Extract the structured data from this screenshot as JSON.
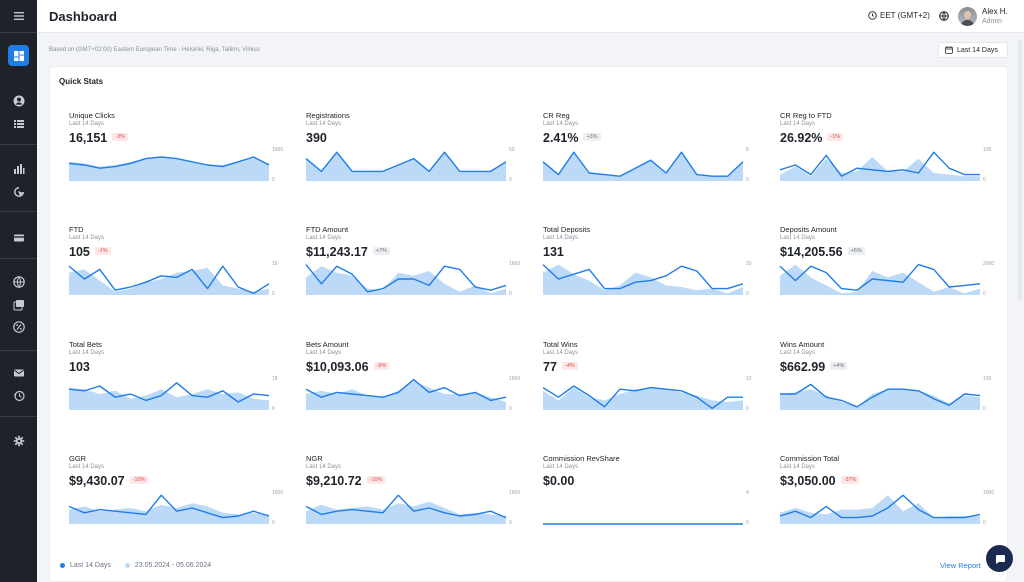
{
  "header": {
    "title": "Dashboard",
    "timezone": "EET (GMT+2)",
    "user_name": "Alex H.",
    "user_role": "Admin"
  },
  "subbar": {
    "based_on": "Based on (GMT+02:00) Eastern European Time - Helsinki, Riga, Tallinn, Vilnius",
    "range_button": "Last 14 Days"
  },
  "sidebar": {
    "icons": [
      "menu-icon",
      "dashboard-icon",
      "user-icon",
      "list-icon",
      "bar-chart-icon",
      "pointer-icon",
      "card-icon",
      "globe-icon",
      "images-icon",
      "percent-icon",
      "mail-icon",
      "history-icon",
      "settings-icon"
    ]
  },
  "colors": {
    "accent": "#1f7de8",
    "line": "#1f7de8",
    "area": "#bcdaf8",
    "sidebar": "#1f2329"
  },
  "quick_stats": {
    "title": "Quick Stats",
    "legend": {
      "current": "Last 14 Days",
      "previous": "23.05.2024 - 05.06.2024"
    },
    "view_report": "View Report",
    "stats": [
      {
        "name": "Unique Clicks",
        "period": "Last 14 Days",
        "value": "16,151",
        "change": "-3%",
        "trend": "neg",
        "ymax": "1600",
        "ymin": "0",
        "current": [
          0.45,
          0.5,
          0.6,
          0.55,
          0.45,
          0.3,
          0.25,
          0.3,
          0.4,
          0.5,
          0.55,
          0.4,
          0.25,
          0.5
        ],
        "previous": [
          0.4,
          0.45,
          0.55,
          0.5,
          0.4,
          0.3,
          0.28,
          0.32,
          0.38,
          0.48,
          0.5,
          0.38,
          0.28,
          0.45
        ]
      },
      {
        "name": "Registrations",
        "period": "Last 14 Days",
        "value": "390",
        "change": "",
        "trend": "none",
        "ymax": "60",
        "ymin": "0",
        "current": [
          0.3,
          0.7,
          0.1,
          0.7,
          0.7,
          0.7,
          0.5,
          0.3,
          0.7,
          0.1,
          0.7,
          0.7,
          0.7,
          0.4
        ],
        "previous": [
          0.3,
          0.7,
          0.1,
          0.7,
          0.7,
          0.7,
          0.5,
          0.3,
          0.7,
          0.1,
          0.7,
          0.7,
          0.7,
          0.4
        ]
      },
      {
        "name": "CR Reg",
        "period": "Last 14 Days",
        "value": "2.41%",
        "change": "+3%",
        "trend": "pos",
        "ymax": "8",
        "ymin": "0",
        "current": [
          0.4,
          0.8,
          0.1,
          0.75,
          0.8,
          0.85,
          0.6,
          0.35,
          0.75,
          0.1,
          0.8,
          0.85,
          0.85,
          0.4
        ],
        "previous": [
          0.4,
          0.8,
          0.1,
          0.75,
          0.8,
          0.85,
          0.6,
          0.35,
          0.75,
          0.1,
          0.8,
          0.85,
          0.85,
          0.4
        ]
      },
      {
        "name": "CR Reg to FTD",
        "period": "Last 14 Days",
        "value": "26.92%",
        "change": "-1%",
        "trend": "neg",
        "ymax": "100",
        "ymin": "0",
        "current": [
          0.65,
          0.5,
          0.8,
          0.2,
          0.85,
          0.6,
          0.65,
          0.7,
          0.65,
          0.75,
          0.1,
          0.6,
          0.8,
          0.8
        ],
        "previous": [
          0.8,
          0.55,
          0.85,
          0.3,
          0.75,
          0.7,
          0.25,
          0.7,
          0.7,
          0.3,
          0.75,
          0.8,
          0.85,
          0.85
        ]
      },
      {
        "name": "FTD",
        "period": "Last 14 Days",
        "value": "105",
        "change": "-1%",
        "trend": "neg",
        "ymax": "18",
        "ymin": "0",
        "current": [
          0.1,
          0.5,
          0.2,
          0.85,
          0.75,
          0.6,
          0.4,
          0.45,
          0.2,
          0.8,
          0.1,
          0.75,
          0.95,
          0.65
        ],
        "previous": [
          0.3,
          0.2,
          0.55,
          0.9,
          0.8,
          0.6,
          0.5,
          0.3,
          0.25,
          0.15,
          0.7,
          0.8,
          0.9,
          0.8
        ]
      },
      {
        "name": "FTD Amount",
        "period": "Last 14 Days",
        "value": "$11,243.17",
        "change": "+7%",
        "trend": "pos",
        "ymax": "1600",
        "ymin": "0",
        "current": [
          0.05,
          0.65,
          0.1,
          0.35,
          0.9,
          0.8,
          0.5,
          0.5,
          0.7,
          0.1,
          0.2,
          0.75,
          0.85,
          0.7
        ],
        "previous": [
          0.45,
          0.1,
          0.3,
          0.4,
          0.8,
          0.85,
          0.3,
          0.4,
          0.25,
          0.65,
          0.9,
          0.7,
          0.95,
          0.8
        ]
      },
      {
        "name": "Total Deposits",
        "period": "Last 14 Days",
        "value": "131",
        "change": "",
        "trend": "none",
        "ymax": "20",
        "ymin": "0",
        "current": [
          0.05,
          0.5,
          0.35,
          0.2,
          0.8,
          0.8,
          0.6,
          0.55,
          0.4,
          0.1,
          0.25,
          0.8,
          0.8,
          0.65
        ],
        "previous": [
          0.3,
          0.05,
          0.35,
          0.55,
          0.85,
          0.7,
          0.3,
          0.45,
          0.7,
          0.75,
          0.85,
          0.8,
          0.95,
          0.75
        ]
      },
      {
        "name": "Deposits Amount",
        "period": "Last 14 Days",
        "value": "$14,205.56",
        "change": "+5%",
        "trend": "pos",
        "ymax": "2000",
        "ymin": "0",
        "current": [
          0.1,
          0.55,
          0.1,
          0.3,
          0.8,
          0.85,
          0.5,
          0.55,
          0.6,
          0.05,
          0.2,
          0.75,
          0.7,
          0.65
        ],
        "previous": [
          0.4,
          0.05,
          0.45,
          0.7,
          0.95,
          0.9,
          0.25,
          0.45,
          0.3,
          0.6,
          0.9,
          0.75,
          0.95,
          0.8
        ]
      },
      {
        "name": "Total Bets",
        "period": "Last 14 Days",
        "value": "103",
        "change": "",
        "trend": "none",
        "ymax": "18",
        "ymin": "0",
        "current": [
          0.35,
          0.4,
          0.25,
          0.6,
          0.5,
          0.7,
          0.55,
          0.15,
          0.55,
          0.6,
          0.4,
          0.75,
          0.5,
          0.55
        ],
        "previous": [
          0.3,
          0.35,
          0.5,
          0.4,
          0.65,
          0.55,
          0.35,
          0.6,
          0.5,
          0.35,
          0.5,
          0.45,
          0.65,
          0.7
        ]
      },
      {
        "name": "Bets Amount",
        "period": "Last 14 Days",
        "value": "$10,093.06",
        "change": "-9%",
        "trend": "neg",
        "ymax": "1600",
        "ymin": "0",
        "current": [
          0.35,
          0.6,
          0.45,
          0.5,
          0.55,
          0.6,
          0.45,
          0.05,
          0.45,
          0.3,
          0.55,
          0.45,
          0.7,
          0.6
        ],
        "previous": [
          0.5,
          0.4,
          0.5,
          0.35,
          0.55,
          0.6,
          0.4,
          0.1,
          0.3,
          0.5,
          0.5,
          0.45,
          0.6,
          0.75
        ]
      },
      {
        "name": "Total Wins",
        "period": "Last 14 Days",
        "value": "77",
        "change": "-4%",
        "trend": "neg",
        "ymax": "12",
        "ymin": "0",
        "current": [
          0.3,
          0.6,
          0.25,
          0.55,
          0.9,
          0.35,
          0.4,
          0.3,
          0.35,
          0.4,
          0.6,
          0.95,
          0.6,
          0.6
        ],
        "previous": [
          0.4,
          0.7,
          0.3,
          0.6,
          0.7,
          0.5,
          0.35,
          0.3,
          0.35,
          0.45,
          0.55,
          0.7,
          0.75,
          0.7
        ]
      },
      {
        "name": "Wins Amount",
        "period": "Last 14 Days",
        "value": "$662.99",
        "change": "+4%",
        "trend": "pos",
        "ymax": "100",
        "ymin": "0",
        "current": [
          0.5,
          0.5,
          0.2,
          0.6,
          0.7,
          0.9,
          0.6,
          0.35,
          0.35,
          0.4,
          0.65,
          0.85,
          0.5,
          0.55
        ],
        "previous": [
          0.5,
          0.45,
          0.35,
          0.55,
          0.75,
          0.9,
          0.5,
          0.35,
          0.35,
          0.4,
          0.55,
          0.8,
          0.55,
          0.6
        ]
      },
      {
        "name": "GGR",
        "period": "Last 14 Days",
        "value": "$9,430.07",
        "change": "-10%",
        "trend": "neg",
        "ymax": "1600",
        "ymin": "0",
        "current": [
          0.45,
          0.65,
          0.55,
          0.6,
          0.65,
          0.7,
          0.1,
          0.6,
          0.5,
          0.65,
          0.8,
          0.75,
          0.6,
          0.75
        ],
        "previous": [
          0.55,
          0.45,
          0.6,
          0.55,
          0.5,
          0.6,
          0.4,
          0.5,
          0.35,
          0.45,
          0.65,
          0.7,
          0.65,
          0.7
        ]
      },
      {
        "name": "NGR",
        "period": "Last 14 Days",
        "value": "$9,210.72",
        "change": "-10%",
        "trend": "neg",
        "ymax": "1600",
        "ymin": "0",
        "current": [
          0.45,
          0.7,
          0.6,
          0.55,
          0.6,
          0.65,
          0.1,
          0.6,
          0.5,
          0.65,
          0.75,
          0.7,
          0.6,
          0.8
        ],
        "previous": [
          0.6,
          0.4,
          0.55,
          0.5,
          0.45,
          0.55,
          0.35,
          0.45,
          0.3,
          0.5,
          0.7,
          0.65,
          0.7,
          0.75
        ]
      },
      {
        "name": "Commission RevShare",
        "period": "Last 14 Days",
        "value": "$0.00",
        "change": "",
        "trend": "none",
        "ymax": "4",
        "ymin": "0",
        "current": [
          1,
          1,
          1,
          1,
          1,
          1,
          1,
          1,
          1,
          1,
          1,
          1,
          1,
          1
        ],
        "previous": [
          1,
          1,
          1,
          1,
          1,
          1,
          1,
          1,
          1,
          1,
          1,
          1,
          1,
          1
        ]
      },
      {
        "name": "Commission Total",
        "period": "Last 14 Days",
        "value": "$3,050.00",
        "change": "-37%",
        "trend": "neg",
        "ymax": "1000",
        "ymin": "0",
        "current": [
          0.75,
          0.6,
          0.8,
          0.45,
          0.8,
          0.8,
          0.75,
          0.5,
          0.1,
          0.55,
          0.8,
          0.8,
          0.8,
          0.7
        ],
        "previous": [
          0.65,
          0.5,
          0.65,
          0.7,
          0.55,
          0.55,
          0.5,
          0.1,
          0.6,
          0.35,
          0.8,
          0.75,
          0.75,
          0.75
        ]
      }
    ]
  }
}
